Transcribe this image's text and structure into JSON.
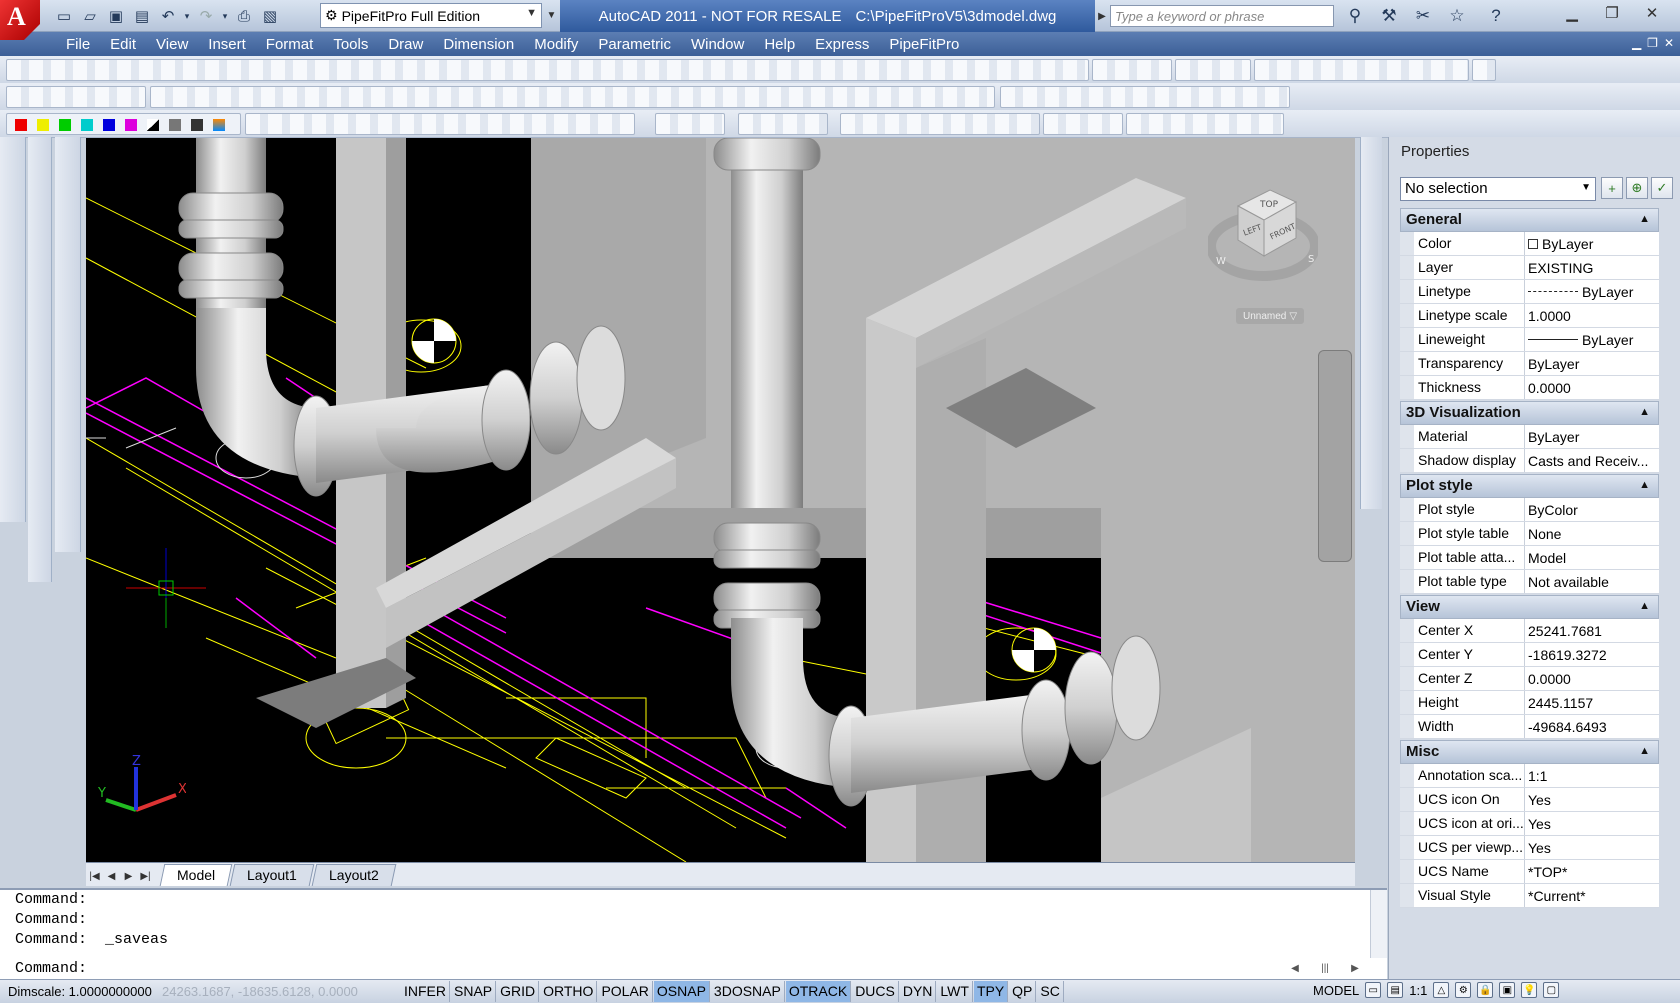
{
  "app": {
    "logo_letter": "A",
    "workspace": "PipeFitPro Full Edition",
    "title_app": "AutoCAD 2011 - NOT FOR RESALE",
    "title_file": "C:\\PipeFitProV5\\3dmodel.dwg",
    "search_placeholder": "Type a keyword or phrase"
  },
  "menu": [
    "File",
    "Edit",
    "View",
    "Insert",
    "Format",
    "Tools",
    "Draw",
    "Dimension",
    "Modify",
    "Parametric",
    "Window",
    "Help",
    "Express",
    "PipeFitPro"
  ],
  "viewport": {
    "viewcube": {
      "top": "TOP",
      "left": "LEFT",
      "front": "FRONT",
      "compass": {
        "w": "W",
        "s": "S"
      }
    },
    "visual_style_label": "Unnamed",
    "ucs": {
      "x": "X",
      "y": "Y",
      "z": "Z"
    }
  },
  "layout_tabs": [
    "Model",
    "Layout1",
    "Layout2"
  ],
  "properties": {
    "title": "Properties",
    "selection": "No selection",
    "sections": [
      {
        "name": "General",
        "rows": [
          {
            "name": "Color",
            "value": "ByLayer"
          },
          {
            "name": "Layer",
            "value": "EXISTING"
          },
          {
            "name": "Linetype",
            "value": "ByLayer"
          },
          {
            "name": "Linetype scale",
            "value": "1.0000"
          },
          {
            "name": "Lineweight",
            "value": "ByLayer"
          },
          {
            "name": "Transparency",
            "value": "ByLayer"
          },
          {
            "name": "Thickness",
            "value": "0.0000"
          }
        ]
      },
      {
        "name": "3D Visualization",
        "rows": [
          {
            "name": "Material",
            "value": "ByLayer"
          },
          {
            "name": "Shadow display",
            "value": "Casts and Receiv..."
          }
        ]
      },
      {
        "name": "Plot style",
        "rows": [
          {
            "name": "Plot style",
            "value": "ByColor"
          },
          {
            "name": "Plot style table",
            "value": "None"
          },
          {
            "name": "Plot table atta...",
            "value": "Model"
          },
          {
            "name": "Plot table type",
            "value": "Not available"
          }
        ]
      },
      {
        "name": "View",
        "rows": [
          {
            "name": "Center X",
            "value": "25241.7681"
          },
          {
            "name": "Center Y",
            "value": "-18619.3272"
          },
          {
            "name": "Center Z",
            "value": "0.0000"
          },
          {
            "name": "Height",
            "value": "2445.1157"
          },
          {
            "name": "Width",
            "value": "-49684.6493"
          }
        ]
      },
      {
        "name": "Misc",
        "rows": [
          {
            "name": "Annotation sca...",
            "value": "1:1"
          },
          {
            "name": "UCS icon On",
            "value": "Yes"
          },
          {
            "name": "UCS icon at ori...",
            "value": "Yes"
          },
          {
            "name": "UCS per viewp...",
            "value": "Yes"
          },
          {
            "name": "UCS Name",
            "value": "*TOP*"
          },
          {
            "name": "Visual Style",
            "value": "*Current*"
          }
        ]
      }
    ]
  },
  "command": {
    "history": [
      "Command:",
      "Command:",
      "Command:  _saveas"
    ],
    "prompt": "Command:"
  },
  "status": {
    "dimscale": "Dimscale: 1.0000000000",
    "coords": "24263.1687, -18635.6128, 0.0000",
    "modes": [
      {
        "label": "INFER",
        "on": false
      },
      {
        "label": "SNAP",
        "on": false
      },
      {
        "label": "GRID",
        "on": false
      },
      {
        "label": "ORTHO",
        "on": false
      },
      {
        "label": "POLAR",
        "on": false
      },
      {
        "label": "OSNAP",
        "on": true
      },
      {
        "label": "3DOSNAP",
        "on": false
      },
      {
        "label": "OTRACK",
        "on": true
      },
      {
        "label": "DUCS",
        "on": false
      },
      {
        "label": "DYN",
        "on": false
      },
      {
        "label": "LWT",
        "on": false
      },
      {
        "label": "TPY",
        "on": true
      },
      {
        "label": "QP",
        "on": false
      },
      {
        "label": "SC",
        "on": false
      }
    ],
    "space": "MODEL",
    "annoscale": "1:1"
  },
  "colors": {
    "active_mode": "#8fb7e6",
    "title_blue": "#2f5a9d",
    "magenta": "#ff00ff",
    "yellow": "#ffff00",
    "pipe": "#d8d8d8",
    "wall": "#b4b4b4"
  }
}
